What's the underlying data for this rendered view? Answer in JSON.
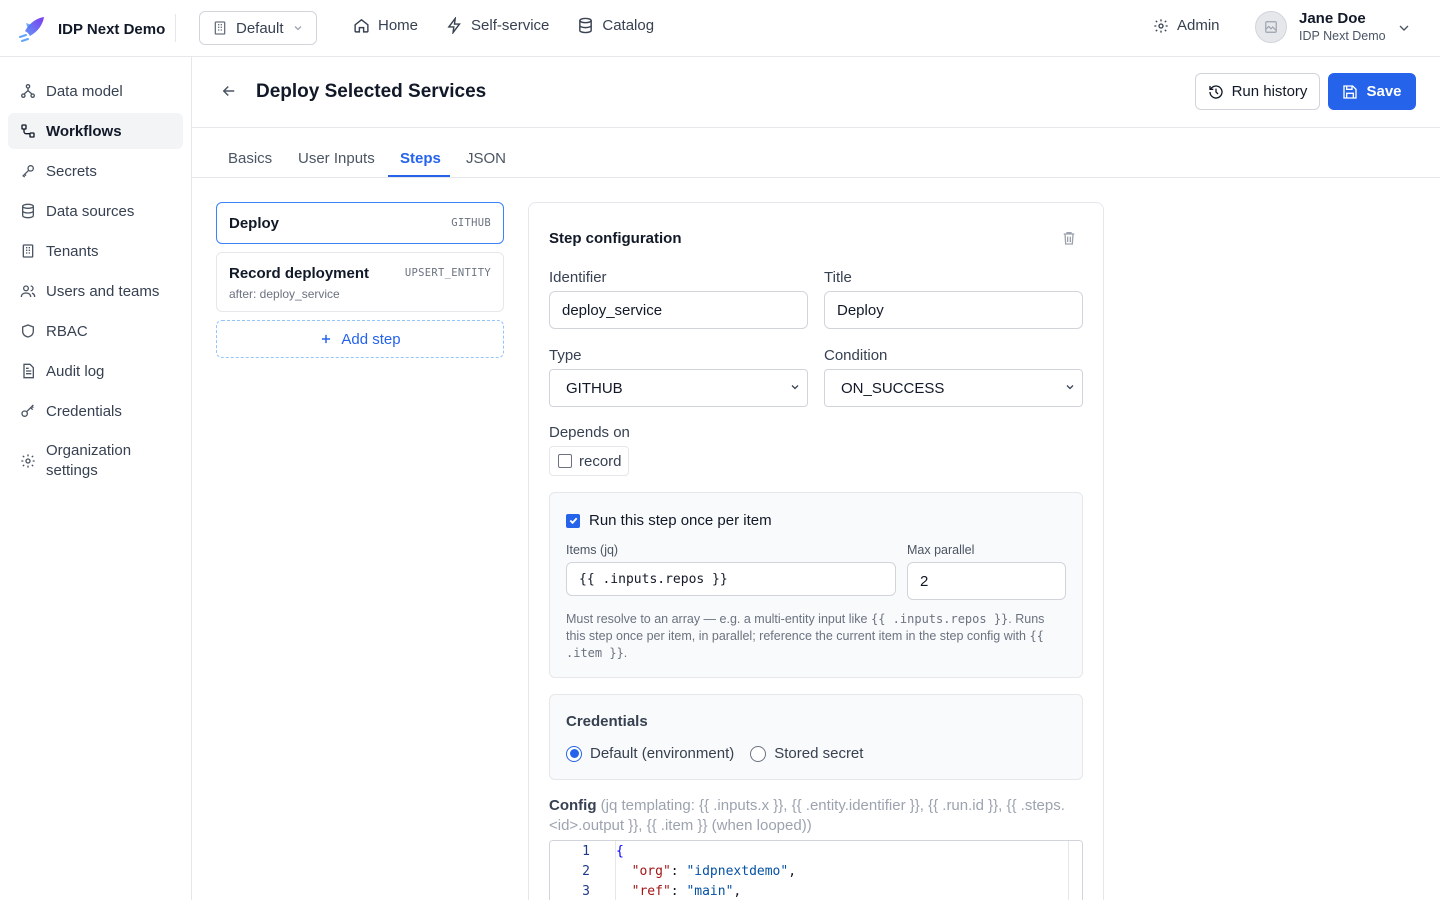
{
  "app": {
    "name": "IDP Next Demo",
    "tenant": "Default"
  },
  "nav": [
    {
      "label": "Home",
      "icon": "home-icon"
    },
    {
      "label": "Self-service",
      "icon": "lightning-icon"
    },
    {
      "label": "Catalog",
      "icon": "database-icon"
    }
  ],
  "admin_label": "Admin",
  "user": {
    "name": "Jane Doe",
    "org": "IDP Next Demo"
  },
  "sidebar": {
    "items": [
      {
        "label": "Data model",
        "icon": "data-model-icon",
        "active": false
      },
      {
        "label": "Workflows",
        "icon": "workflow-icon",
        "active": true
      },
      {
        "label": "Secrets",
        "icon": "key-icon",
        "active": false
      },
      {
        "label": "Data sources",
        "icon": "database-icon",
        "active": false
      },
      {
        "label": "Tenants",
        "icon": "building-icon",
        "active": false
      },
      {
        "label": "Users and teams",
        "icon": "users-icon",
        "active": false
      },
      {
        "label": "RBAC",
        "icon": "shield-icon",
        "active": false
      },
      {
        "label": "Audit log",
        "icon": "document-icon",
        "active": false
      },
      {
        "label": "Credentials",
        "icon": "key-round-icon",
        "active": false
      },
      {
        "label": "Organization",
        "label2": "settings",
        "icon": "gear-icon",
        "active": false
      }
    ]
  },
  "page": {
    "title": "Deploy Selected Services",
    "run_history_label": "Run history",
    "save_label": "Save"
  },
  "tabs": [
    {
      "label": "Basics",
      "active": false
    },
    {
      "label": "User Inputs",
      "active": false
    },
    {
      "label": "Steps",
      "active": true
    },
    {
      "label": "JSON",
      "active": false
    }
  ],
  "steps": [
    {
      "title": "Deploy",
      "type": "GITHUB",
      "sub": "",
      "selected": true
    },
    {
      "title": "Record deployment",
      "type": "UPSERT_ENTITY",
      "sub": "after: deploy_service",
      "selected": false
    }
  ],
  "add_step_label": "Add step",
  "config": {
    "heading": "Step configuration",
    "identifier_label": "Identifier",
    "identifier_value": "deploy_service",
    "title_label": "Title",
    "title_value": "Deploy",
    "type_label": "Type",
    "type_value": "GITHUB",
    "condition_label": "Condition",
    "condition_value": "ON_SUCCESS",
    "depends_label": "Depends on",
    "depends_option": "record",
    "depends_checked": false,
    "loop": {
      "checkbox_label": "Run this step once per item",
      "checked": true,
      "items_label": "Items (jq)",
      "items_value": "{{ .inputs.repos }}",
      "max_parallel_label": "Max parallel",
      "max_parallel_value": "2",
      "help_1": "Must resolve to an array — e.g. a multi-entity input like ",
      "help_code_1": "{{ .inputs.repos }}",
      "help_2": ". Runs this step once per item, in parallel; reference the current item in the step config with ",
      "help_code_2": "{{ .item }}",
      "help_3": "."
    },
    "credentials": {
      "heading": "Credentials",
      "option_default": "Default (environment)",
      "option_stored": "Stored secret",
      "selected": "default"
    },
    "config_label": "Config",
    "config_hint": "(jq templating: {{ .inputs.x }}, {{ .entity.identifier }}, {{ .run.id }}, {{ .steps.<id>.output }}, {{ .item }} (when looped))",
    "code_lines": [
      {
        "n": "1",
        "text": "{"
      },
      {
        "n": "2",
        "key": "\"org\"",
        "value": "\"idpnextdemo\""
      },
      {
        "n": "3",
        "key": "\"ref\"",
        "value": "\"main\""
      }
    ]
  },
  "colors": {
    "accent": "#2563eb",
    "border": "#e5e7eb"
  }
}
